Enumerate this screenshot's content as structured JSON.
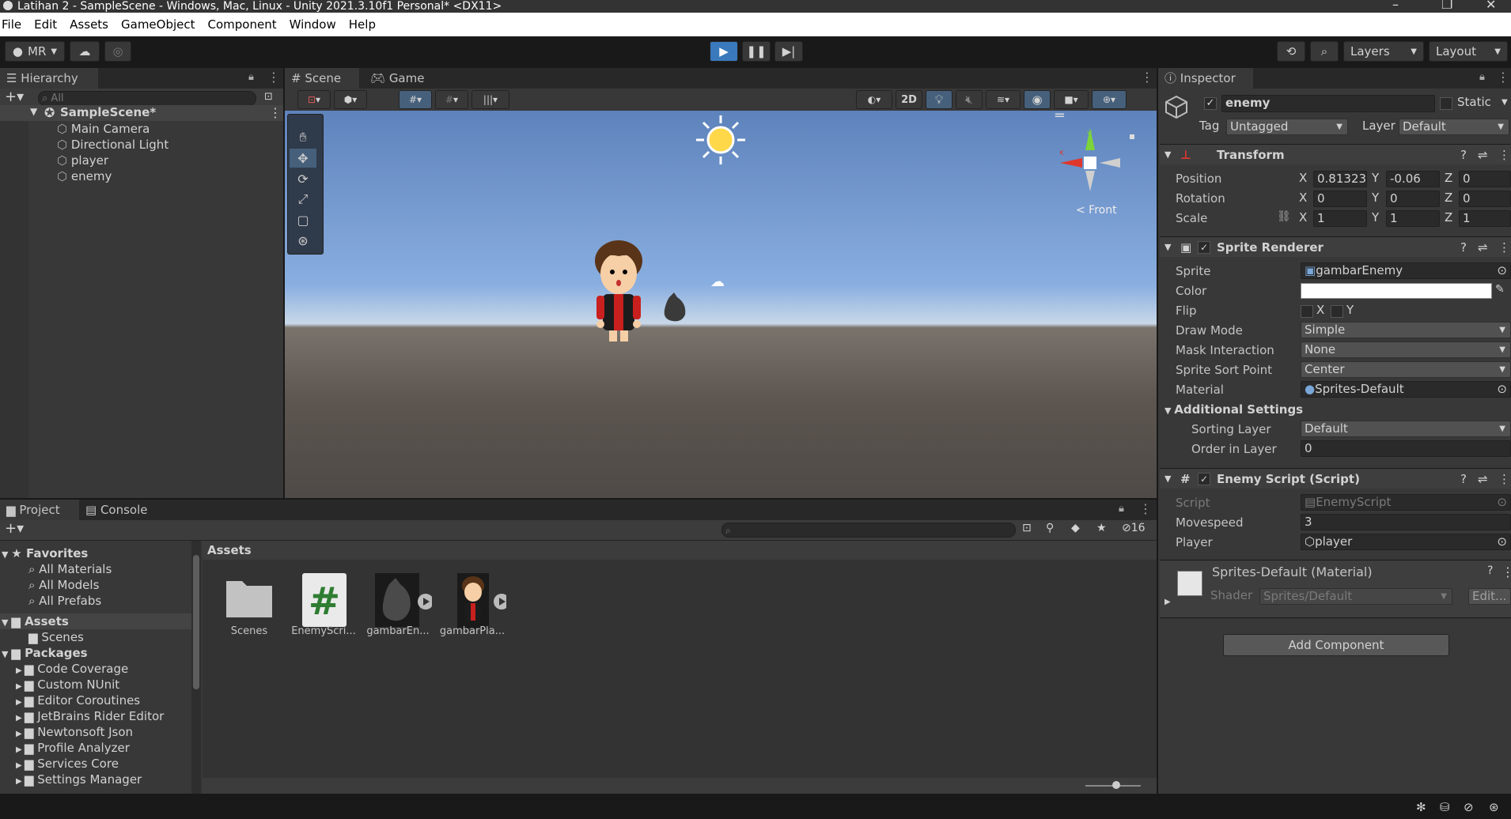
{
  "window": {
    "title": "Latihan 2 - SampleScene - Windows, Mac, Linux - Unity 2021.3.10f1 Personal* <DX11>"
  },
  "menu": [
    "File",
    "Edit",
    "Assets",
    "GameObject",
    "Component",
    "Window",
    "Help"
  ],
  "toolbar": {
    "account": "MR",
    "layers": "Layers",
    "layout": "Layout"
  },
  "hierarchy": {
    "tab": "Hierarchy",
    "search_placeholder": "All",
    "scene": "SampleScene*",
    "items": [
      "Main Camera",
      "Directional Light",
      "player",
      "enemy"
    ]
  },
  "scene_tabs": {
    "scene": "Scene",
    "game": "Game",
    "mode_2d": "2D",
    "gizmo_label": "< Front"
  },
  "inspector": {
    "tab": "Inspector",
    "object_name": "enemy",
    "static_label": "Static",
    "tag_label": "Tag",
    "tag_value": "Untagged",
    "layer_label": "Layer",
    "layer_value": "Default",
    "transform": {
      "title": "Transform",
      "position_label": "Position",
      "position": {
        "x": "0.81323",
        "y": "-0.06",
        "z": "0"
      },
      "rotation_label": "Rotation",
      "rotation": {
        "x": "0",
        "y": "0",
        "z": "0"
      },
      "scale_label": "Scale",
      "scale": {
        "x": "1",
        "y": "1",
        "z": "1"
      }
    },
    "sprite_renderer": {
      "title": "Sprite Renderer",
      "sprite_label": "Sprite",
      "sprite": "gambarEnemy",
      "color_label": "Color",
      "flip_label": "Flip",
      "flip_x": "X",
      "flip_y": "Y",
      "draw_mode_label": "Draw Mode",
      "draw_mode": "Simple",
      "mask_label": "Mask Interaction",
      "mask": "None",
      "sort_point_label": "Sprite Sort Point",
      "sort_point": "Center",
      "material_label": "Material",
      "material": "Sprites-Default",
      "additional": "Additional Settings",
      "sorting_layer_label": "Sorting Layer",
      "sorting_layer": "Default",
      "order_label": "Order in Layer",
      "order": "0"
    },
    "enemy_script": {
      "title": "Enemy Script (Script)",
      "script_label": "Script",
      "script": "EnemyScript",
      "movespeed_label": "Movespeed",
      "movespeed": "3",
      "player_label": "Player",
      "player": "player"
    },
    "material": {
      "title": "Sprites-Default (Material)",
      "shader_label": "Shader",
      "shader": "Sprites/Default",
      "edit": "Edit..."
    },
    "add_component": "Add Component"
  },
  "project": {
    "tab_project": "Project",
    "tab_console": "Console",
    "favorites": "Favorites",
    "favorite_items": [
      "All Materials",
      "All Models",
      "All Prefabs"
    ],
    "assets": "Assets",
    "asset_children": [
      "Scenes"
    ],
    "packages": "Packages",
    "package_items": [
      "Code Coverage",
      "Custom NUnit",
      "Editor Coroutines",
      "JetBrains Rider Editor",
      "Newtonsoft Json",
      "Profile Analyzer",
      "Services Core",
      "Settings Manager"
    ],
    "breadcrumb": "Assets",
    "hidden_count": "16",
    "grid": [
      "Scenes",
      "EnemyScri...",
      "gambarEn...",
      "gambarPla..."
    ]
  },
  "colors": {
    "accent": "#3a79bb",
    "panel": "#383838",
    "dark": "#191919"
  }
}
